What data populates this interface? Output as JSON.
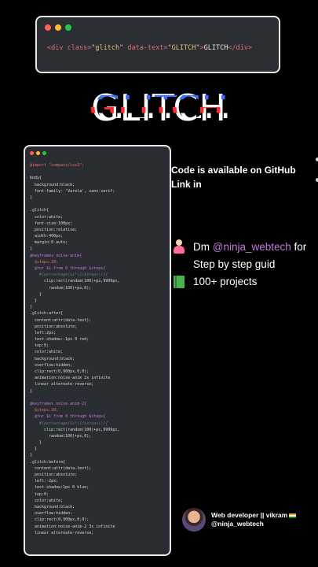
{
  "top_card": {
    "code": {
      "open_tag": "<div class=",
      "class_val": "\"glitch\"",
      "attr": " data-text=",
      "text_val": "\"GLITCH\"",
      "close_open": ">",
      "content": "GLITCH",
      "close_tag": "</div>"
    }
  },
  "title": "GLITCH",
  "code_lines": [
    {
      "t": "@import \"compass/css3\";",
      "c": "c-pink"
    },
    {
      "t": "",
      "c": ""
    },
    {
      "t": "body{",
      "c": ""
    },
    {
      "t": "  background:black;",
      "c": ""
    },
    {
      "t": "  font-family: 'Varela', sans-serif;",
      "c": ""
    },
    {
      "t": "}",
      "c": ""
    },
    {
      "t": "",
      "c": ""
    },
    {
      "t": ".glitch{",
      "c": ""
    },
    {
      "t": "  color:white;",
      "c": ""
    },
    {
      "t": "  font-size:100px;",
      "c": ""
    },
    {
      "t": "  position:relative;",
      "c": ""
    },
    {
      "t": "  width:400px;",
      "c": ""
    },
    {
      "t": "  margin:0 auto;",
      "c": ""
    },
    {
      "t": "}",
      "c": ""
    },
    {
      "t": "@keyframes noise-anim{",
      "c": "c-purple"
    },
    {
      "t": "  $steps:20;",
      "c": "c-pink"
    },
    {
      "t": "  @for $i from 0 through $steps{",
      "c": "c-purple"
    },
    {
      "t": "    #{percentage($i*(1/$steps))}{",
      "c": "c-gray"
    },
    {
      "t": "      clip:rect(random(100)+px,9999px,",
      "c": ""
    },
    {
      "t": "        random(100)+px,0);",
      "c": ""
    },
    {
      "t": "    }",
      "c": ""
    },
    {
      "t": "  }",
      "c": ""
    },
    {
      "t": "}",
      "c": ""
    },
    {
      "t": ".glitch:after{",
      "c": ""
    },
    {
      "t": "  content:attr(data-text);",
      "c": ""
    },
    {
      "t": "  position:absolute;",
      "c": ""
    },
    {
      "t": "  left:2px;",
      "c": ""
    },
    {
      "t": "  text-shadow:-1px 0 red;",
      "c": ""
    },
    {
      "t": "  top:0;",
      "c": ""
    },
    {
      "t": "  color:white;",
      "c": ""
    },
    {
      "t": "  background:black;",
      "c": ""
    },
    {
      "t": "  overflow:hidden;",
      "c": ""
    },
    {
      "t": "  clip:rect(0,900px,0,0);",
      "c": ""
    },
    {
      "t": "  animation:noise-anim 2s infinite",
      "c": ""
    },
    {
      "t": "  linear alternate-reverse;",
      "c": ""
    },
    {
      "t": "}",
      "c": ""
    },
    {
      "t": "",
      "c": ""
    },
    {
      "t": "@keyframes noise-anim-2{",
      "c": "c-purple"
    },
    {
      "t": "  $steps:20;",
      "c": "c-pink"
    },
    {
      "t": "  @for $i from 0 through $steps{",
      "c": "c-purple"
    },
    {
      "t": "    #{percentage($i*(1/$steps))}{",
      "c": "c-gray"
    },
    {
      "t": "      clip:rect(random(100)+px,9999px,",
      "c": ""
    },
    {
      "t": "        random(100)+px,0);",
      "c": ""
    },
    {
      "t": "    }",
      "c": ""
    },
    {
      "t": "  }",
      "c": ""
    },
    {
      "t": "}",
      "c": ""
    },
    {
      "t": ".glitch:before{",
      "c": ""
    },
    {
      "t": "  content:attr(data-text);",
      "c": ""
    },
    {
      "t": "  position:absolute;",
      "c": ""
    },
    {
      "t": "  left:-2px;",
      "c": ""
    },
    {
      "t": "  text-shadow:1px 0 blue;",
      "c": ""
    },
    {
      "t": "  top:0;",
      "c": ""
    },
    {
      "t": "  color:white;",
      "c": ""
    },
    {
      "t": "  background:black;",
      "c": ""
    },
    {
      "t": "  overflow:hidden;",
      "c": ""
    },
    {
      "t": "  clip:rect(0,900px,0,0);",
      "c": ""
    },
    {
      "t": "  animation:noise-anim-2 3s infinite",
      "c": ""
    },
    {
      "t": "  linear alternate-reverse;",
      "c": ""
    }
  ],
  "info": {
    "line1": "Code is available on GitHub",
    "line2": "Link in"
  },
  "promo": {
    "dm_prefix": "Dm ",
    "handle": "@ninja_webtech",
    "dm_suffix": " for",
    "guide": "Step by step guid",
    "projects": "100+ projects",
    "person_icon": "person-icon",
    "book_icon": "book-icon"
  },
  "profile": {
    "name": "Web developer || vikram",
    "handle": "@ninja_webtech"
  }
}
